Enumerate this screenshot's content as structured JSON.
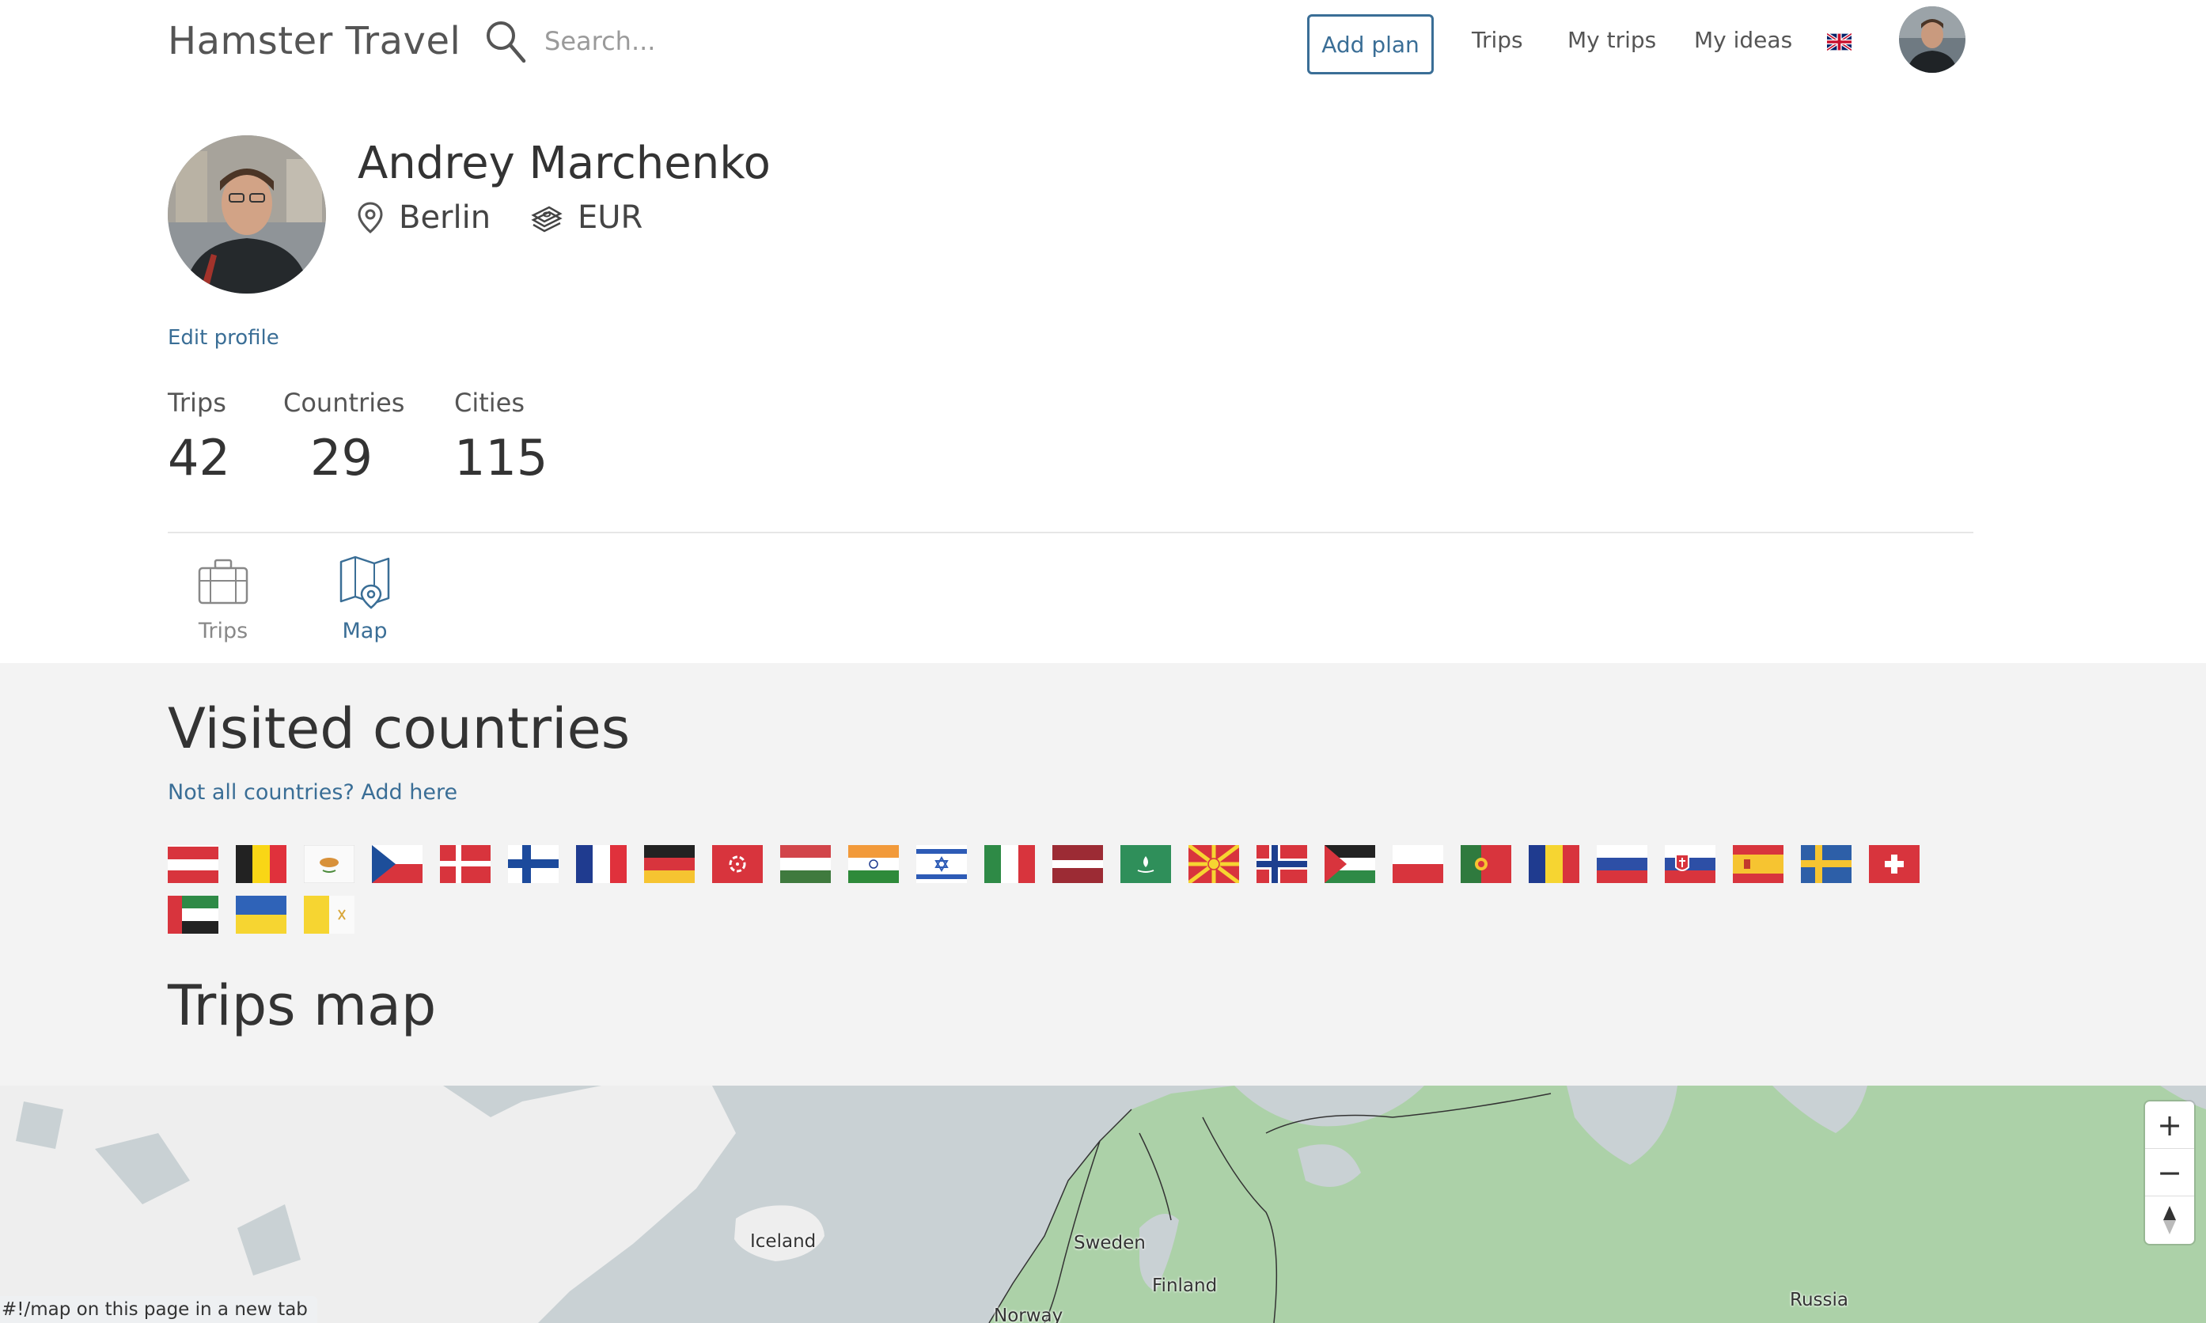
{
  "header": {
    "logo": "Hamster Travel",
    "search_placeholder": "Search...",
    "add_plan_label": "Add plan",
    "nav": [
      "Trips",
      "My trips",
      "My ideas"
    ]
  },
  "profile": {
    "name": "Andrey Marchenko",
    "location": "Berlin",
    "currency": "EUR",
    "edit_label": "Edit profile"
  },
  "stats": [
    {
      "label": "Trips",
      "value": "42"
    },
    {
      "label": "Countries",
      "value": "29"
    },
    {
      "label": "Cities",
      "value": "115"
    }
  ],
  "tabs": [
    {
      "label": "Trips",
      "icon": "suitcase-icon"
    },
    {
      "label": "Map",
      "icon": "map-pin-icon"
    }
  ],
  "visited": {
    "title": "Visited countries",
    "add_link": "Not all countries? Add here",
    "flags": [
      "austria",
      "belgium",
      "cyprus",
      "czechia",
      "denmark",
      "finland",
      "france",
      "germany",
      "hong-kong",
      "hungary",
      "india",
      "israel",
      "italy",
      "latvia",
      "macau",
      "north-macedonia",
      "norway",
      "palestine",
      "poland",
      "portugal",
      "romania",
      "russia",
      "slovakia",
      "spain",
      "sweden",
      "switzerland",
      "uae",
      "ukraine",
      "vatican"
    ]
  },
  "map": {
    "title": "Trips map",
    "labels": [
      "Iceland",
      "Sweden",
      "Finland",
      "Norway",
      "Russia"
    ],
    "zoom_in": "+",
    "zoom_out": "−",
    "compass": "▲",
    "status": "#!/map on this page in a new tab",
    "colors": {
      "visited": "#acd1a8",
      "sea": "#c9d1d4",
      "land": "#f2f2f2"
    }
  }
}
